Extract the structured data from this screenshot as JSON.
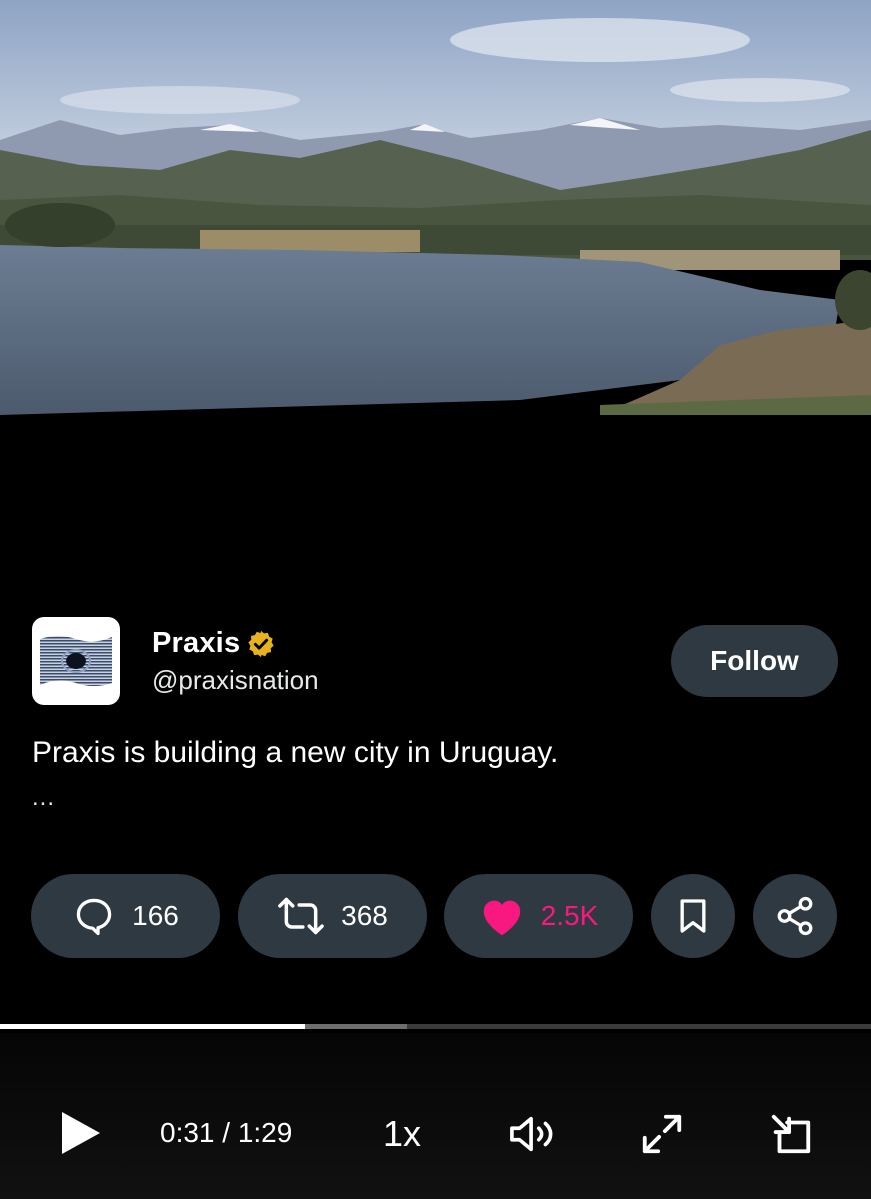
{
  "author": {
    "display_name": "Praxis",
    "handle": "@praxisnation",
    "avatar_icon": "flag-wave-logo",
    "verified_icon": "verified-badge-icon",
    "verified_color": "#e8b21e"
  },
  "follow": {
    "label": "Follow"
  },
  "post": {
    "text": "Praxis is building a new city in Uruguay.",
    "more": "..."
  },
  "actions": {
    "reply": {
      "icon": "reply-bubble-icon",
      "count": "166"
    },
    "repost": {
      "icon": "repost-icon",
      "count": "368"
    },
    "like": {
      "icon": "heart-icon",
      "count": "2.5K",
      "color": "#f91880",
      "liked": true
    },
    "bookmark": {
      "icon": "bookmark-icon"
    },
    "share": {
      "icon": "share-icon"
    }
  },
  "player": {
    "elapsed": "0:31",
    "duration": "1:29",
    "time_display": "0:31 / 1:29",
    "progress": 0.35,
    "buffered": 0.467,
    "speed": "1x",
    "play_icon": "play-icon",
    "volume_icon": "volume-icon",
    "fullscreen_icon": "fullscreen-icon",
    "pip_icon": "picture-in-picture-icon"
  }
}
